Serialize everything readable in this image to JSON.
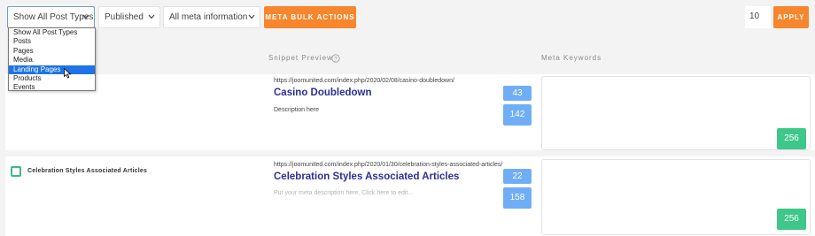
{
  "toolbar": {
    "post_type_select": "Show All Post Types",
    "status_select": "Published",
    "meta_info_select": "All meta information",
    "bulk_button": "META BULK ACTIONS",
    "per_page_value": "10",
    "apply_button": "APPLY"
  },
  "post_type_dropdown": {
    "options": [
      "Show All Post Types",
      "Posts",
      "Pages",
      "Media",
      "Landing Pages",
      "Products",
      "Events"
    ],
    "highlighted": "Landing Pages"
  },
  "columns": {
    "snippet_preview": "Snippet Preview",
    "meta_keywords": "Meta Keywords"
  },
  "rows": [
    {
      "title": "",
      "url": "https://joomunited.com/index.php/2020/02/08/casino-doubledown/",
      "snippet_title": "Casino Doubledown",
      "description": "Description here",
      "title_count": "43",
      "desc_count": "142",
      "keywords_count": "256"
    },
    {
      "title": "Celebration Styles Associated Articles",
      "url": "https://joomunited.com/index.php/2020/01/30/celebration-styles-associated-articles/",
      "snippet_title": "Celebration Styles Associated Articles",
      "description": "Put your meta description here. Click here to edit...",
      "title_count": "22",
      "desc_count": "158",
      "keywords_count": "256"
    }
  ],
  "colors": {
    "accent_orange": "#f7862d",
    "count_blue": "#6faef7",
    "count_green": "#3ec78a",
    "snippet_title": "#2b2f9a",
    "dropdown_highlight": "#1e73e8"
  }
}
